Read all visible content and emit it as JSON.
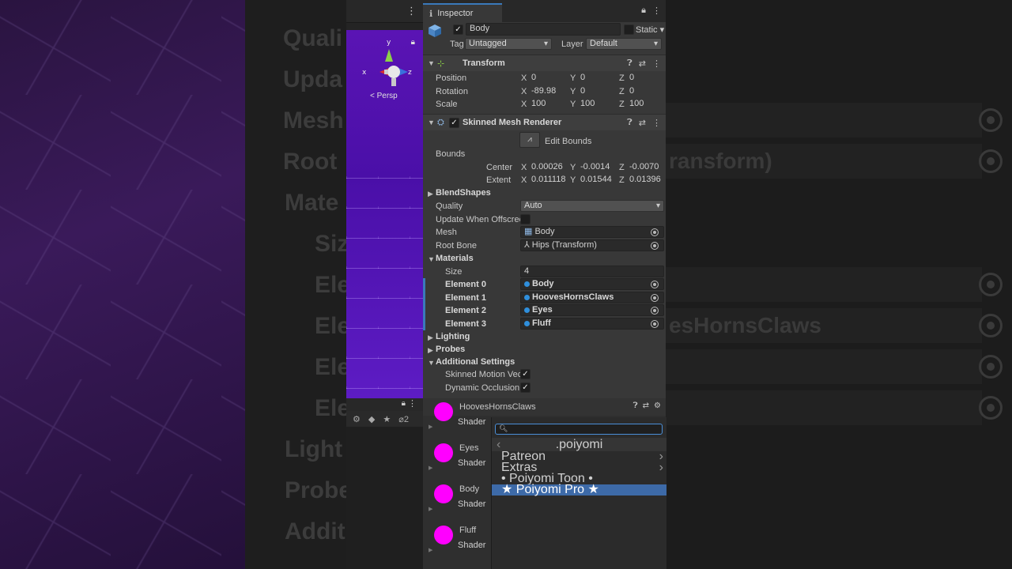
{
  "background_ghost": {
    "left_items": [
      "Quali",
      "Upda",
      "Mesh",
      "Root",
      "Mate",
      "Siz",
      "Ele",
      "Ele",
      "Ele",
      "Ele",
      "Light",
      "Probe",
      "Addit"
    ],
    "right_items": [
      "ransform)",
      "esHornsClaws"
    ]
  },
  "scene": {
    "persp_label": "< Persp",
    "axis_labels": {
      "y": "y",
      "x": "x",
      "z": "z"
    },
    "toolbar_count": "2"
  },
  "inspector": {
    "tab_label": "Inspector",
    "object": {
      "name": "Body",
      "static_label": "Static",
      "tag_label": "Tag",
      "tag_value": "Untagged",
      "layer_label": "Layer",
      "layer_value": "Default"
    },
    "transform": {
      "title": "Transform",
      "position": {
        "label": "Position",
        "x": "0",
        "y": "0",
        "z": "0"
      },
      "rotation": {
        "label": "Rotation",
        "x": "-89.98",
        "y": "0",
        "z": "0"
      },
      "scale": {
        "label": "Scale",
        "x": "100",
        "y": "100",
        "z": "100"
      }
    },
    "skinned_mesh_renderer": {
      "title": "Skinned Mesh Renderer",
      "edit_bounds_label": "Edit Bounds",
      "bounds_label": "Bounds",
      "center": {
        "label": "Center",
        "x": "0.00026",
        "y": "-0.0014",
        "z": "-0.0070"
      },
      "extent": {
        "label": "Extent",
        "x": "0.011118",
        "y": "0.01544",
        "z": "0.01396"
      },
      "blendshapes_label": "BlendShapes",
      "quality_label": "Quality",
      "quality_value": "Auto",
      "update_offscreen_label": "Update When Offscree",
      "mesh_label": "Mesh",
      "mesh_value": "Body",
      "root_bone_label": "Root Bone",
      "root_bone_value": "Hips (Transform)",
      "materials_label": "Materials",
      "size_label": "Size",
      "size_value": "4",
      "elements": [
        {
          "label": "Element 0",
          "value": "Body"
        },
        {
          "label": "Element 1",
          "value": "HoovesHornsClaws"
        },
        {
          "label": "Element 2",
          "value": "Eyes"
        },
        {
          "label": "Element 3",
          "value": "Fluff"
        }
      ],
      "lighting_label": "Lighting",
      "probes_label": "Probes",
      "additional_label": "Additional Settings",
      "skinned_motion_label": "Skinned Motion Vec",
      "dynamic_occlusion_label": "Dynamic Occlusion"
    }
  },
  "materials_panel": {
    "entries": [
      {
        "name": "HoovesHornsClaws",
        "shader_label": "Shader"
      },
      {
        "name": "Eyes",
        "shader_label": "Shader"
      },
      {
        "name": "Body",
        "shader_label": "Shader"
      },
      {
        "name": "Fluff",
        "shader_label": "Shader"
      }
    ],
    "ball_color": "#ff00ff"
  },
  "shader_popup": {
    "header": ".poiyomi",
    "items": [
      {
        "label": "Patreon",
        "submenu": true
      },
      {
        "label": "Extras",
        "submenu": true
      },
      {
        "label": "• Poiyomi Toon •",
        "submenu": false
      },
      {
        "label": "★ Poiyomi Pro ★",
        "submenu": false,
        "selected": true
      }
    ]
  },
  "colors": {
    "accent": "#3a79bb",
    "selection": "#3d6aa8",
    "scene": "#5a14b4"
  }
}
